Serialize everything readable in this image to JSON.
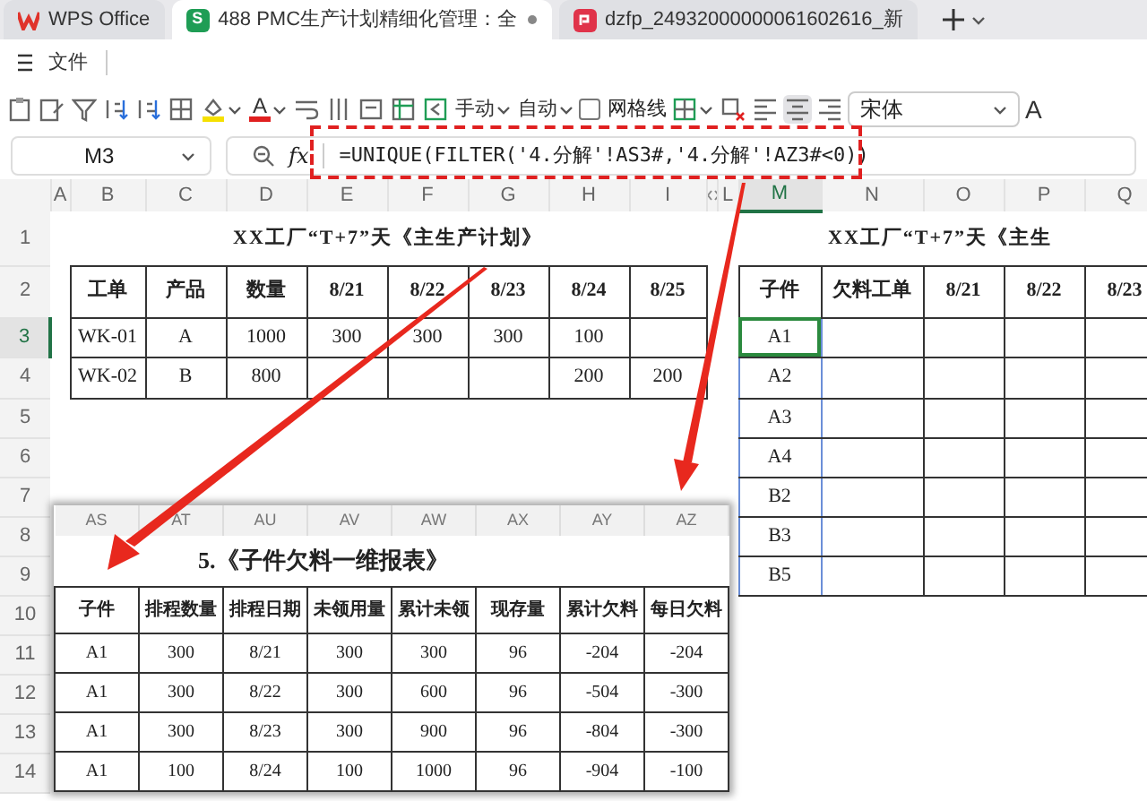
{
  "tabs": [
    {
      "kind": "home",
      "label": "WPS Office",
      "selected": false
    },
    {
      "kind": "sheet",
      "badge": "S",
      "label": "488 PMC生产计划精细化管理：全",
      "selected": true
    },
    {
      "kind": "pdf",
      "label": "dzfp_24932000000061602616_新",
      "selected": false
    }
  ],
  "menu": {
    "label": "文件"
  },
  "toolbar": {
    "font_color_letter": "A",
    "buttons": [
      {
        "label": "手动"
      },
      {
        "label": "自动"
      }
    ],
    "gridlines": {
      "label": "网格线",
      "checked": false
    },
    "align": [
      {
        "kind": "left",
        "selected": false
      },
      {
        "kind": "center",
        "selected": true
      },
      {
        "kind": "right",
        "selected": false
      }
    ],
    "font": "宋体",
    "grow_letter": "A"
  },
  "formula_bar": {
    "cell": "M3",
    "fx": "fx",
    "formula": "=UNIQUE(FILTER('4.分解'!AS3#,'4.分解'!AZ3#<0))"
  },
  "sheet": {
    "columns": [
      {
        "label": "A",
        "selected": false
      },
      {
        "label": "B",
        "selected": false
      },
      {
        "label": "C",
        "selected": false
      },
      {
        "label": "D",
        "selected": false
      },
      {
        "label": "E",
        "selected": false
      },
      {
        "label": "F",
        "selected": false
      },
      {
        "label": "G",
        "selected": false
      },
      {
        "label": "H",
        "selected": false
      },
      {
        "label": "I",
        "selected": false
      },
      {
        "label": "L",
        "selected": false,
        "hidden_before": true
      },
      {
        "label": "M",
        "selected": true
      },
      {
        "label": "N",
        "selected": false
      },
      {
        "label": "O",
        "selected": false
      },
      {
        "label": "P",
        "selected": false
      },
      {
        "label": "Q",
        "selected": false
      }
    ],
    "rows": [
      {
        "label": "1",
        "selected": false
      },
      {
        "label": "2",
        "selected": false
      },
      {
        "label": "3",
        "selected": true
      },
      {
        "label": "4",
        "selected": false
      },
      {
        "label": "5",
        "selected": false
      },
      {
        "label": "6",
        "selected": false
      },
      {
        "label": "7",
        "selected": false
      },
      {
        "label": "8",
        "selected": false
      },
      {
        "label": "9",
        "selected": false
      },
      {
        "label": "10",
        "selected": false
      },
      {
        "label": "11",
        "selected": false
      },
      {
        "label": "12",
        "selected": false
      },
      {
        "label": "13",
        "selected": false
      },
      {
        "label": "14",
        "selected": false
      }
    ]
  },
  "plan_table": {
    "title": "XX工厂“T+7”天《主生产计划》",
    "header": [
      "工单",
      "产品",
      "数量",
      "8/21",
      "8/22",
      "8/23",
      "8/24",
      "8/25"
    ],
    "rows": [
      [
        "WK-01",
        "A",
        "1000",
        "300",
        "300",
        "300",
        "100",
        null
      ],
      [
        "WK-02",
        "B",
        "800",
        null,
        null,
        null,
        "200",
        "200"
      ]
    ]
  },
  "child_table": {
    "title": "XX工厂“T+7”天《主生",
    "header": [
      "子件",
      "欠料工单",
      "8/21",
      "8/22",
      "8/23"
    ],
    "rows": [
      {
        "part": "A1",
        "selected": true
      },
      {
        "part": "A2",
        "selected": false
      },
      {
        "part": "A3",
        "selected": false
      },
      {
        "part": "A4",
        "selected": false
      },
      {
        "part": "B2",
        "selected": false
      },
      {
        "part": "B3",
        "selected": false
      },
      {
        "part": "B5",
        "selected": false
      }
    ]
  },
  "inset": {
    "columns": [
      "AS",
      "AT",
      "AU",
      "AV",
      "AW",
      "AX",
      "AY",
      "AZ"
    ],
    "title": "5.《子件欠料一维报表》",
    "header": [
      "子件",
      "排程数量",
      "排程日期",
      "未领用量",
      "累计未领",
      "现存量",
      "累计欠料",
      "每日欠料"
    ],
    "rows": [
      [
        "A1",
        "300",
        "8/21",
        "300",
        "300",
        "96",
        "-204",
        "-204"
      ],
      [
        "A1",
        "300",
        "8/22",
        "300",
        "600",
        "96",
        "-504",
        "-300"
      ],
      [
        "A1",
        "300",
        "8/23",
        "300",
        "900",
        "96",
        "-804",
        "-300"
      ],
      [
        "A1",
        "100",
        "8/24",
        "100",
        "1000",
        "96",
        "-904",
        "-100"
      ]
    ]
  }
}
